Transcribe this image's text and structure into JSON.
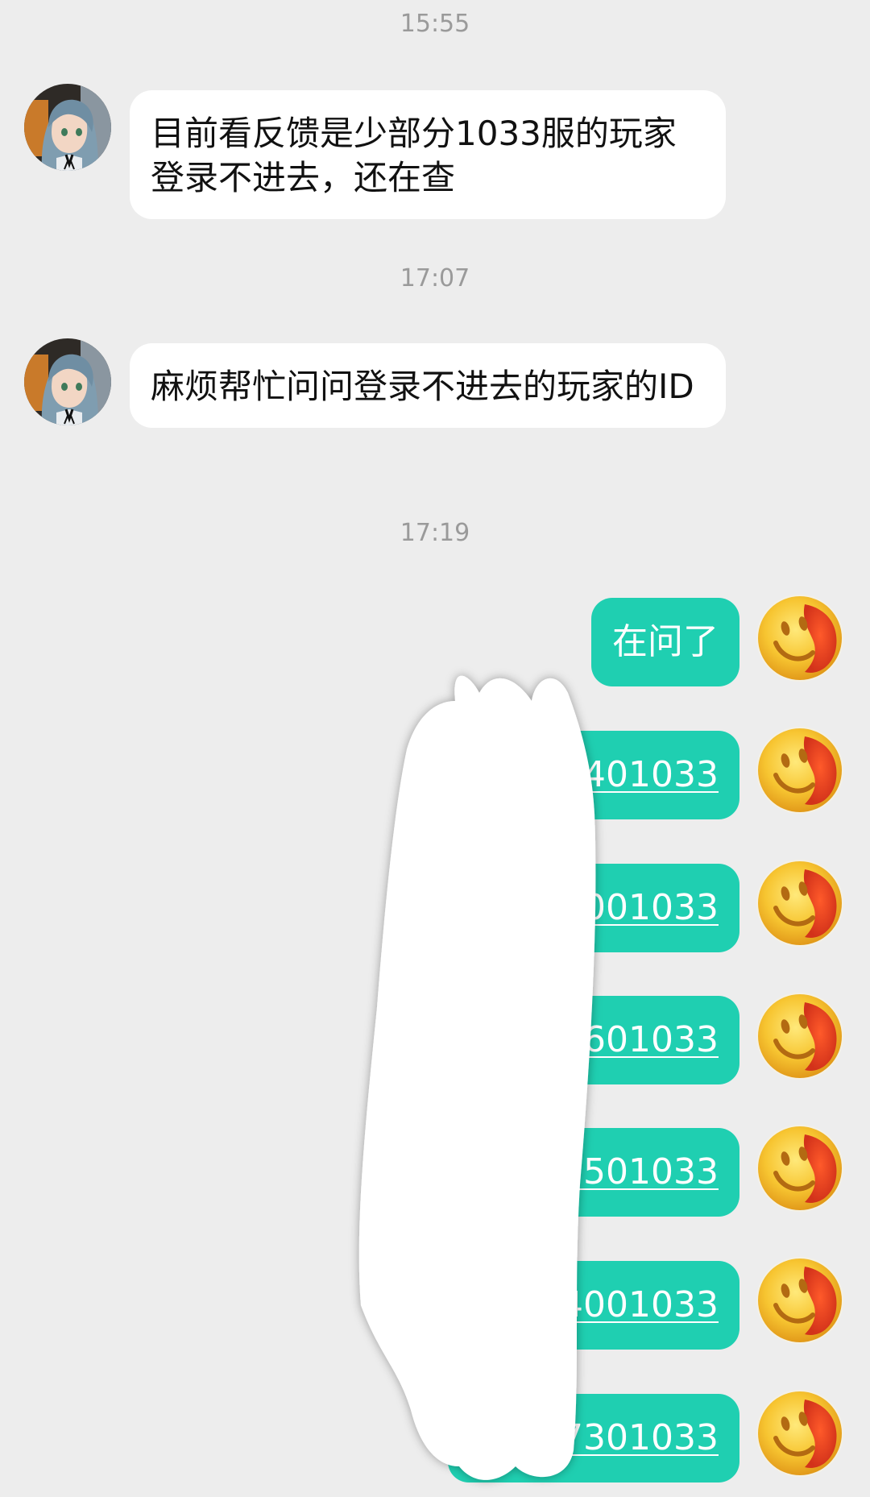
{
  "conversation": {
    "messages": [
      {
        "type": "time",
        "text": "15:55"
      },
      {
        "type": "incoming",
        "text": "目前看反馈是少部分1033服的玩家登录不进去，还在查"
      },
      {
        "type": "time",
        "text": "17:07"
      },
      {
        "type": "incoming",
        "text": "麻烦帮忙问问登录不进去的玩家的ID"
      },
      {
        "type": "time",
        "text": "17:19"
      },
      {
        "type": "outgoing",
        "text": "在问了"
      },
      {
        "type": "outgoing",
        "text": "401033"
      },
      {
        "type": "outgoing",
        "text": "001033"
      },
      {
        "type": "outgoing",
        "text": "601033"
      },
      {
        "type": "outgoing",
        "text": "3501033"
      },
      {
        "type": "outgoing",
        "text": "4001033"
      },
      {
        "type": "outgoing",
        "text": "7301033"
      }
    ]
  },
  "icons": {
    "incoming_avatar": "anime-girl-avatar",
    "outgoing_avatar": "smiley-face-avatar"
  },
  "colors": {
    "background": "#ededed",
    "incoming_bubble": "#ffffff",
    "outgoing_bubble": "#1fcfb1",
    "timestamp_text": "#9a9a9a",
    "redaction": "#ffffff"
  }
}
